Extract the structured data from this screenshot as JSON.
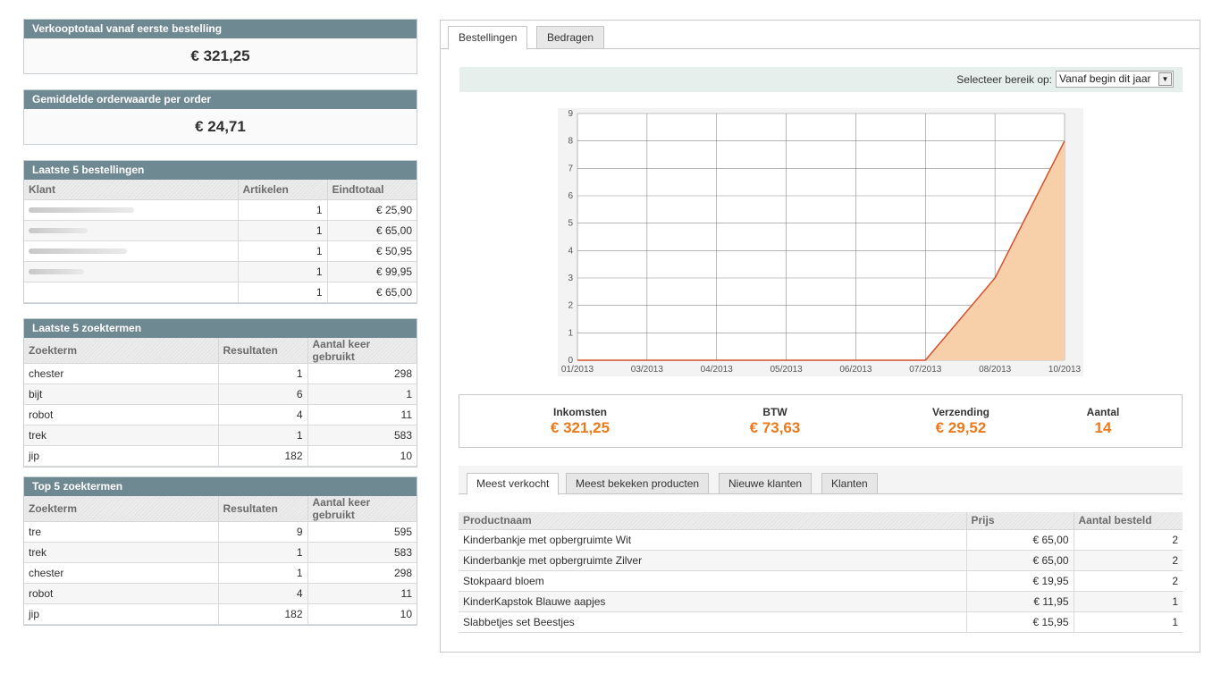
{
  "sales_total": {
    "title": "Verkooptotaal vanaf eerste bestelling",
    "value": "€ 321,25"
  },
  "average_order": {
    "title": "Gemiddelde orderwaarde per order",
    "value": "€ 24,71"
  },
  "last_orders": {
    "title": "Laatste 5 bestellingen",
    "columns": [
      "Klant",
      "Artikelen",
      "Eindtotaal"
    ],
    "rows": [
      {
        "items": "1",
        "total": "€ 25,90"
      },
      {
        "items": "1",
        "total": "€ 65,00"
      },
      {
        "items": "1",
        "total": "€ 50,95"
      },
      {
        "items": "1",
        "total": "€ 99,95"
      },
      {
        "items": "1",
        "total": "€ 65,00"
      }
    ]
  },
  "last_searches": {
    "title": "Laatste 5 zoektermen",
    "columns": [
      "Zoekterm",
      "Resultaten",
      "Aantal keer gebruikt"
    ],
    "rows": [
      {
        "term": "chester",
        "results": "1",
        "uses": "298"
      },
      {
        "term": "bijt",
        "results": "6",
        "uses": "1"
      },
      {
        "term": "robot",
        "results": "4",
        "uses": "11"
      },
      {
        "term": "trek",
        "results": "1",
        "uses": "583"
      },
      {
        "term": "jip",
        "results": "182",
        "uses": "10"
      }
    ]
  },
  "top_searches": {
    "title": "Top 5 zoektermen",
    "columns": [
      "Zoekterm",
      "Resultaten",
      "Aantal keer gebruikt"
    ],
    "rows": [
      {
        "term": "tre",
        "results": "9",
        "uses": "595"
      },
      {
        "term": "trek",
        "results": "1",
        "uses": "583"
      },
      {
        "term": "chester",
        "results": "1",
        "uses": "298"
      },
      {
        "term": "robot",
        "results": "4",
        "uses": "11"
      },
      {
        "term": "jip",
        "results": "182",
        "uses": "10"
      }
    ]
  },
  "tabs": [
    "Bestellingen",
    "Bedragen"
  ],
  "range": {
    "label": "Selecteer bereik op:",
    "selected": "Vanaf begin dit jaar"
  },
  "chart_data": {
    "type": "area",
    "x_ticks": [
      "01/2013",
      "03/2013",
      "04/2013",
      "05/2013",
      "06/2013",
      "07/2013",
      "08/2013",
      "10/2013"
    ],
    "series": [
      {
        "values": [
          0,
          0,
          0,
          0,
          0,
          0,
          3,
          8
        ]
      }
    ],
    "ylim": [
      0,
      9
    ],
    "y_ticks": [
      0,
      1,
      2,
      3,
      4,
      5,
      6,
      7,
      8,
      9
    ],
    "grid": true,
    "colors": {
      "line": "#d4502a",
      "fill": "#f7cfa9",
      "grid": "#8a8a8a"
    }
  },
  "totals": [
    {
      "label": "Inkomsten",
      "value": "€ 321,25"
    },
    {
      "label": "BTW",
      "value": "€ 73,63"
    },
    {
      "label": "Verzending",
      "value": "€ 29,52"
    },
    {
      "label": "Aantal",
      "value": "14"
    }
  ],
  "subtabs": [
    "Meest verkocht",
    "Meest bekeken producten",
    "Nieuwe klanten",
    "Klanten"
  ],
  "products": {
    "columns": [
      "Productnaam",
      "Prijs",
      "Aantal besteld"
    ],
    "rows": [
      {
        "name": "Kinderbankje met opbergruimte Wit",
        "price": "€ 65,00",
        "qty": "2"
      },
      {
        "name": "Kinderbankje met opbergruimte Zilver",
        "price": "€ 65,00",
        "qty": "2"
      },
      {
        "name": "Stokpaard bloem",
        "price": "€ 19,95",
        "qty": "2"
      },
      {
        "name": "KinderKapstok Blauwe aapjes",
        "price": "€ 11,95",
        "qty": "1"
      },
      {
        "name": "Slabbetjes set Beestjes",
        "price": "€ 15,95",
        "qty": "1"
      }
    ]
  }
}
